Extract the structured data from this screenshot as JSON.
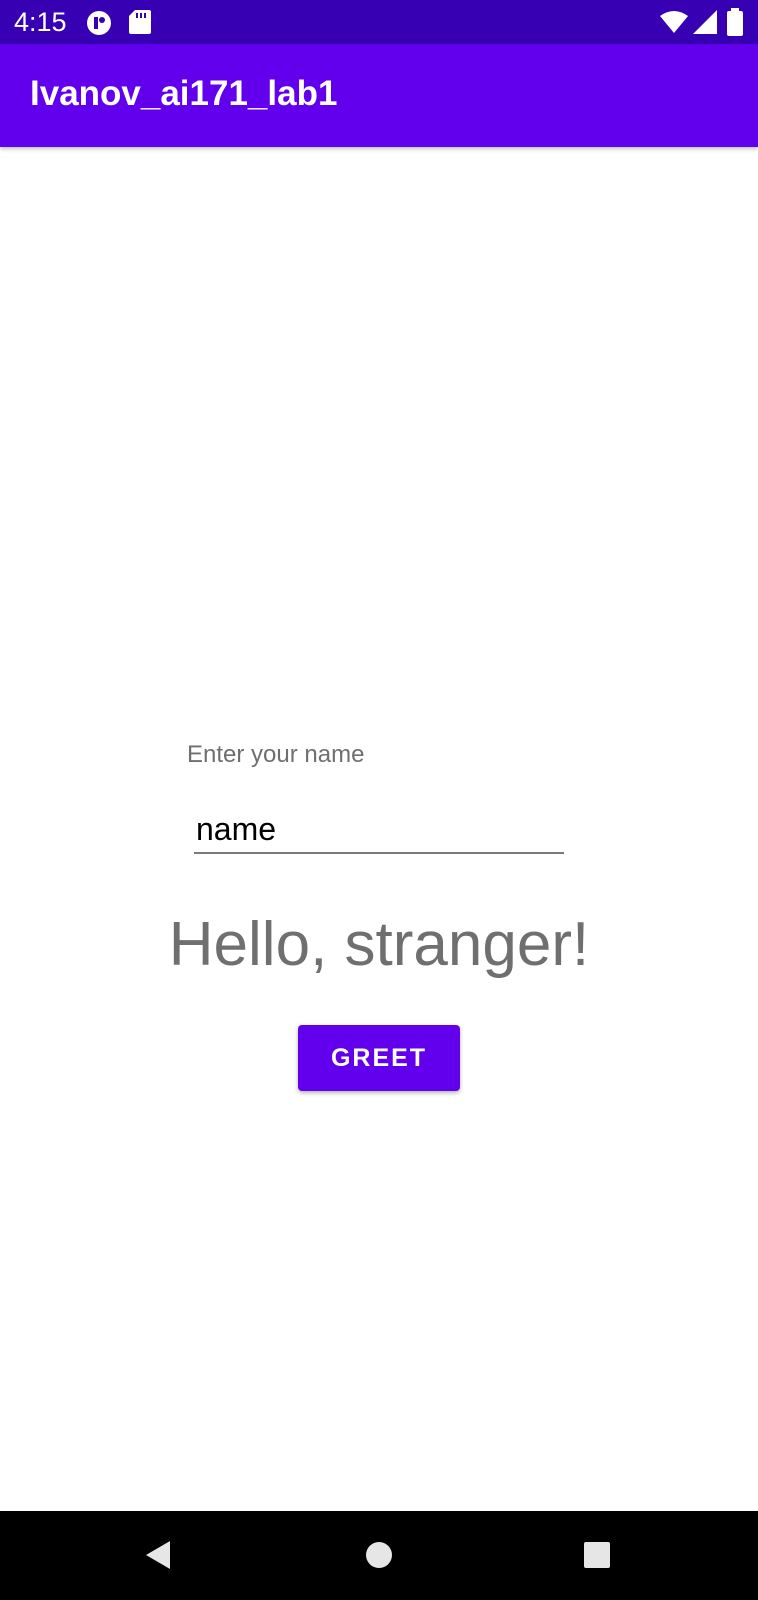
{
  "status_bar": {
    "time": "4:15",
    "left_icons": [
      "notification-app-icon",
      "sd-card-icon"
    ],
    "right_icons": [
      "wifi-icon",
      "cell-signal-icon",
      "battery-icon"
    ]
  },
  "app_bar": {
    "title": "Ivanov_ai171_lab1"
  },
  "form": {
    "prompt_label": "Enter your name",
    "name_input": {
      "value": "name",
      "placeholder": ""
    },
    "greeting_text": "Hello, stranger!",
    "greet_button_label": "GREET"
  },
  "nav_bar": {
    "buttons": [
      "back-icon",
      "home-icon",
      "recents-icon"
    ]
  },
  "colors": {
    "status_bar": "#3700b3",
    "primary": "#6200ee",
    "text_secondary": "#6f6f6f"
  }
}
